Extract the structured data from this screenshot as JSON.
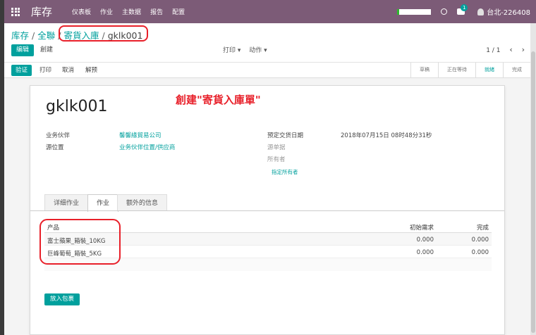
{
  "navbar": {
    "brand": "库存",
    "menu": [
      "仪表板",
      "作业",
      "主数据",
      "报告",
      "配置"
    ],
    "notification_count": "1",
    "user": "台北-226408"
  },
  "breadcrumb": {
    "root": "库存",
    "level1": "全聯",
    "level2": "寄貨入庫",
    "current": "gklk001"
  },
  "control": {
    "edit": "编辑",
    "create": "創建",
    "print": "打印 ▾",
    "action": "动作 ▾",
    "pager": "1 / 1",
    "prev": "‹",
    "next": "›"
  },
  "statusbar": {
    "validate": "验证",
    "print": "打印",
    "cancel": "取消",
    "unreserve": "解预",
    "stages": [
      "草稿",
      "正在等待",
      "就緒",
      "完成"
    ],
    "current_stage": "就緒"
  },
  "form": {
    "title": "gklk001",
    "annotation": "創建\"寄貨入庫單\"",
    "partner_label": "业务伙伴",
    "partner_value": "馨馨緣貿易公司",
    "source_label": "源位置",
    "source_value": "业务伙伴位置/供应商",
    "date_label": "预定交货日期",
    "date_value": "2018年07月15日 08时48分31秒",
    "origin_label": "源单据",
    "owner_label": "所有者",
    "assign_owner": "指定所有者"
  },
  "tabs": [
    "详细作业",
    "作业",
    "额外的信息"
  ],
  "active_tab": "作业",
  "table": {
    "columns": [
      "产品",
      "初始需求",
      "完成"
    ],
    "rows": [
      {
        "product": "富士蘋果_箱裝_10KG",
        "demand": "0.000",
        "done": "0.000"
      },
      {
        "product": "巨峰葡萄_箱裝_5KG",
        "demand": "0.000",
        "done": "0.000"
      }
    ]
  },
  "put_in_pack": "放入包裹",
  "colors": {
    "navbar": "#7c5b77",
    "accent": "#00a09d",
    "annotation": "#e8202a"
  }
}
